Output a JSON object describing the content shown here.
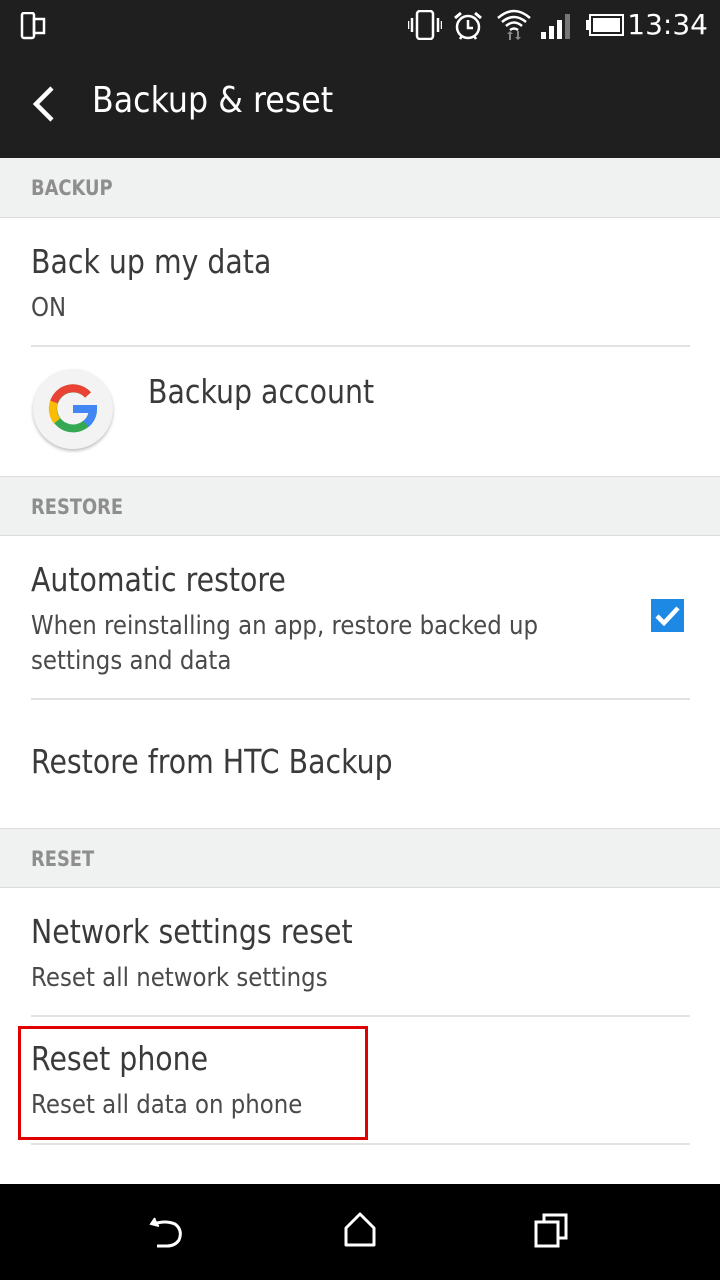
{
  "status_bar": {
    "time": "13:34",
    "icons": [
      "dual-screen-icon",
      "vibrate-icon",
      "alarm-icon",
      "wifi-icon",
      "signal-icon",
      "battery-icon"
    ]
  },
  "app_bar": {
    "title": "Backup & reset",
    "back_icon": "chevron-left-icon"
  },
  "sections": {
    "backup": {
      "header": "BACKUP",
      "items": [
        {
          "title": "Back up my data",
          "subtitle": "ON"
        },
        {
          "title": "Backup account",
          "icon": "google-icon"
        }
      ]
    },
    "restore": {
      "header": "RESTORE",
      "items": [
        {
          "title": "Automatic restore",
          "subtitle_line1": "When reinstalling an app, restore backed up",
          "subtitle_line2": "settings and data",
          "checked": true
        },
        {
          "title": "Restore from HTC Backup"
        }
      ]
    },
    "reset": {
      "header": "RESET",
      "items": [
        {
          "title": "Network settings reset",
          "subtitle": "Reset all network settings"
        },
        {
          "title": "Reset phone",
          "subtitle": "Reset all data on phone",
          "highlighted": true
        }
      ]
    }
  },
  "colors": {
    "checkbox": "#1e88e5",
    "highlight_box": "#e00000",
    "bar_bg": "#1f1f20"
  },
  "nav_bar": {
    "buttons": [
      "back-icon",
      "home-icon",
      "recents-icon"
    ]
  }
}
